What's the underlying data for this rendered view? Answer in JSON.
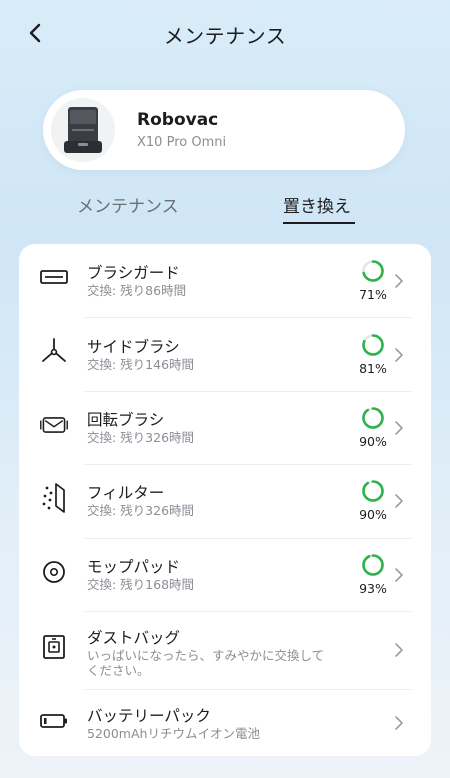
{
  "header": {
    "title": "メンテナンス"
  },
  "device": {
    "name": "Robovac",
    "model": "X10 Pro Omni"
  },
  "tabs": [
    {
      "label": "メンテナンス",
      "active": false
    },
    {
      "label": "置き換え",
      "active": true
    }
  ],
  "accent_color": "#2db34a",
  "items": [
    {
      "icon": "brush-guard-icon",
      "title": "ブラシガード",
      "subtitle": "交換: 残り86時間",
      "percent_label": "71%",
      "percent": 71
    },
    {
      "icon": "side-brush-icon",
      "title": "サイドブラシ",
      "subtitle": "交換: 残り146時間",
      "percent_label": "81%",
      "percent": 81
    },
    {
      "icon": "rolling-brush-icon",
      "title": "回転ブラシ",
      "subtitle": "交換: 残り326時間",
      "percent_label": "90%",
      "percent": 90
    },
    {
      "icon": "filter-icon",
      "title": "フィルター",
      "subtitle": "交換: 残り326時間",
      "percent_label": "90%",
      "percent": 90
    },
    {
      "icon": "mop-pad-icon",
      "title": "モップパッド",
      "subtitle": "交換: 残り168時間",
      "percent_label": "93%",
      "percent": 93
    },
    {
      "icon": "dust-bag-icon",
      "title": "ダストバッグ",
      "subtitle_line1": "いっぱいになったら、すみやかに交換して",
      "subtitle_line2": "ください。"
    },
    {
      "icon": "battery-icon",
      "title": "バッテリーパック",
      "subtitle": "5200mAhリチウムイオン電池"
    }
  ]
}
